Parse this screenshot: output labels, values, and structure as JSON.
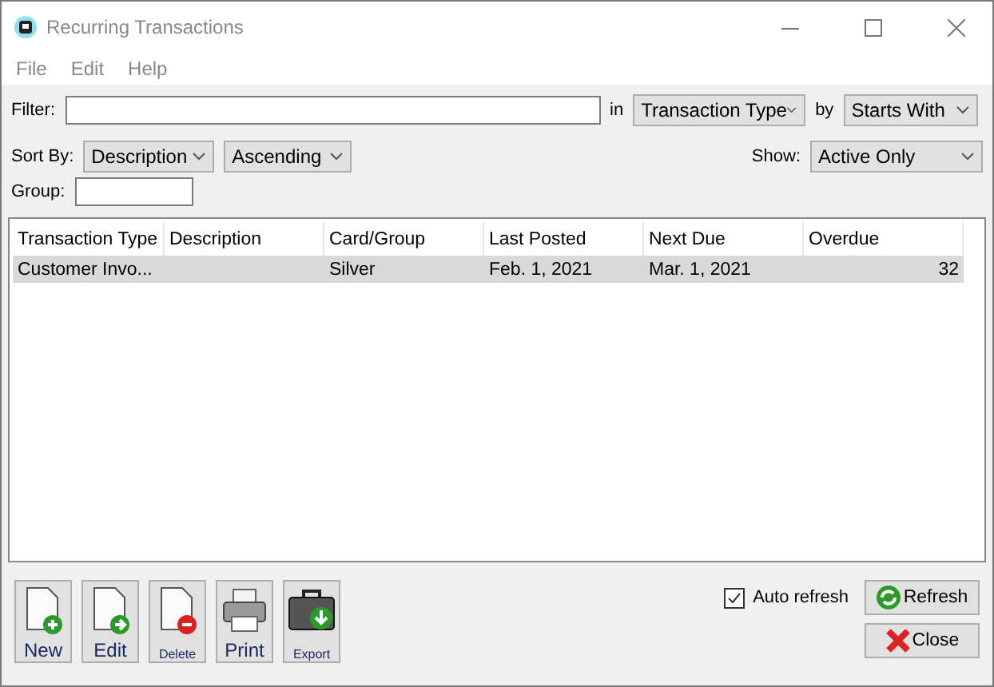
{
  "window": {
    "title": "Recurring Transactions"
  },
  "menu": [
    "File",
    "Edit",
    "Help"
  ],
  "filter": {
    "label": "Filter:",
    "in_label": "in",
    "in_value": "Transaction Type",
    "by_label": "by",
    "by_value": "Starts With"
  },
  "sort": {
    "label": "Sort By:",
    "field": "Description",
    "order": "Ascending"
  },
  "show": {
    "label": "Show:",
    "value": "Active Only"
  },
  "group": {
    "label": "Group:"
  },
  "table": {
    "columns": [
      "Transaction Type",
      "Description",
      "Card/Group",
      "Last Posted",
      "Next Due",
      "Overdue"
    ],
    "rows": [
      {
        "selected": true,
        "cells": [
          "Customer Invo...",
          "",
          "Silver",
          "Feb. 1, 2021",
          "Mar. 1, 2021",
          "32"
        ]
      }
    ]
  },
  "toolbar": [
    {
      "kind": "new",
      "label": "New",
      "small": false
    },
    {
      "kind": "edit",
      "label": "Edit",
      "small": false
    },
    {
      "kind": "delete",
      "label": "Delete",
      "small": true
    },
    {
      "kind": "print",
      "label": "Print",
      "small": false
    },
    {
      "kind": "export",
      "label": "Export",
      "small": true
    }
  ],
  "auto_refresh": {
    "label": "Auto refresh",
    "checked": true
  },
  "buttons": [
    {
      "kind": "refresh",
      "label": "Refresh"
    },
    {
      "kind": "close",
      "label": "Close"
    }
  ]
}
